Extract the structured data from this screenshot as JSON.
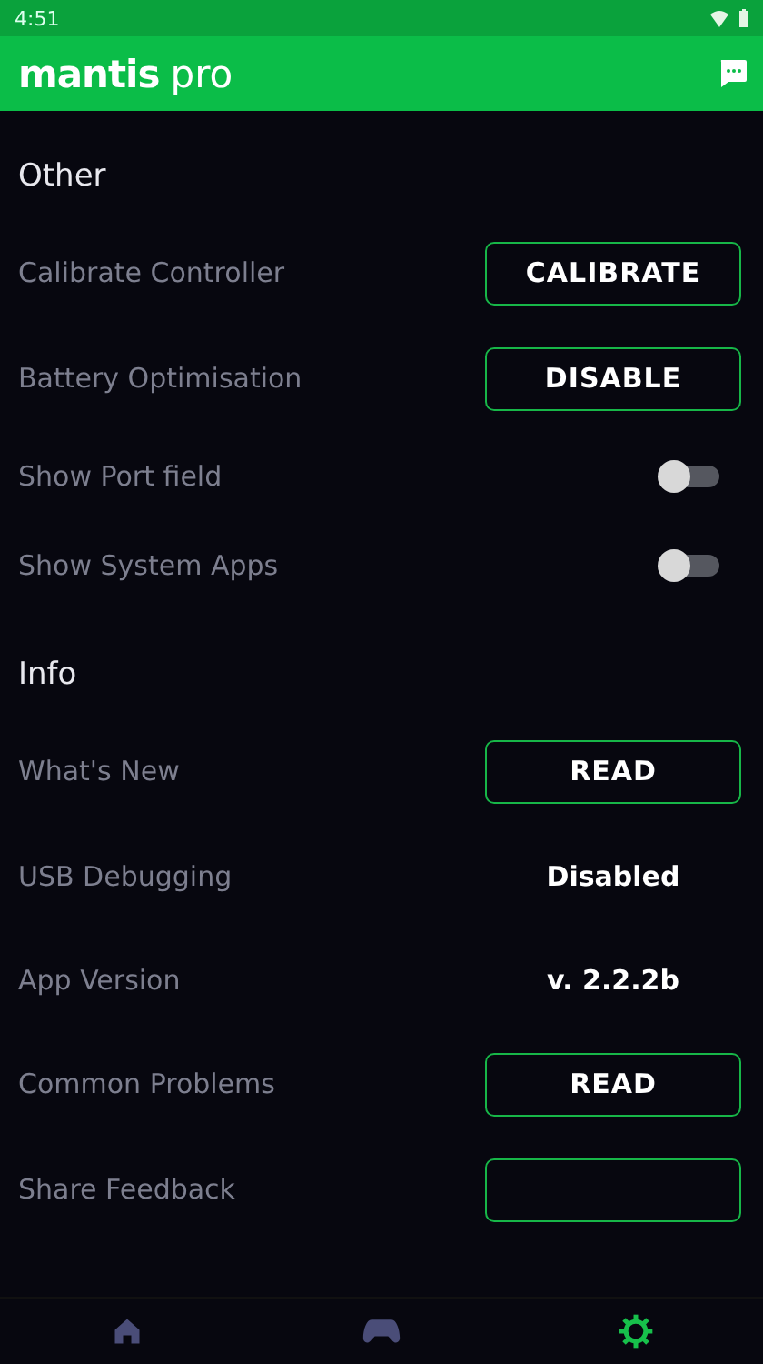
{
  "status_bar": {
    "time": "4:51"
  },
  "app_bar": {
    "title_bold": "mantis",
    "title_light": "pro"
  },
  "sections": [
    {
      "title": "Other",
      "rows": [
        {
          "kind": "button",
          "label": "Calibrate Controller",
          "button": "CALIBRATE"
        },
        {
          "kind": "button",
          "label": "Battery Optimisation",
          "button": "DISABLE"
        },
        {
          "kind": "toggle",
          "label": "Show Port field",
          "on": false
        },
        {
          "kind": "toggle",
          "label": "Show System Apps",
          "on": false
        }
      ]
    },
    {
      "title": "Info",
      "rows": [
        {
          "kind": "button",
          "label": "What's New",
          "button": "READ"
        },
        {
          "kind": "value",
          "label": "USB Debugging",
          "value": "Disabled"
        },
        {
          "kind": "value",
          "label": "App Version",
          "value": "v. 2.2.2b"
        },
        {
          "kind": "button",
          "label": "Common Problems",
          "button": "READ"
        },
        {
          "kind": "button",
          "label": "Share Feedback"
        }
      ]
    }
  ],
  "nav": [
    {
      "kind": "home",
      "selected": false
    },
    {
      "kind": "gamepad",
      "selected": false
    },
    {
      "kind": "settings",
      "selected": true
    }
  ]
}
